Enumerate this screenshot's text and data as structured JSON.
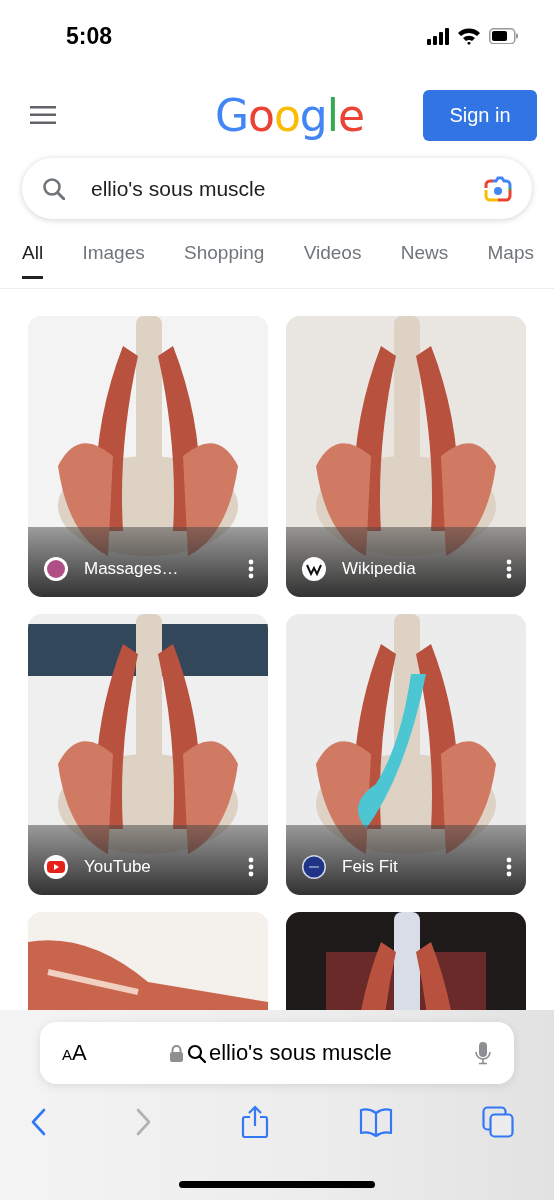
{
  "status_bar": {
    "time": "5:08"
  },
  "header": {
    "logo": "Google",
    "sign_in_button": "Sign in"
  },
  "search": {
    "value": "ellio's sous muscle"
  },
  "tabs": [
    {
      "label": "All",
      "selected": true
    },
    {
      "label": "Images",
      "selected": false
    },
    {
      "label": "Shopping",
      "selected": false
    },
    {
      "label": "Videos",
      "selected": false
    },
    {
      "label": "News",
      "selected": false
    },
    {
      "label": "Maps",
      "selected": false
    }
  ],
  "results": [
    {
      "kind": "picture",
      "source": "Massages…"
    },
    {
      "kind": "picture",
      "source": "Wikipedia"
    },
    {
      "kind": "picture",
      "source": "YouTube"
    },
    {
      "kind": "picture",
      "source": "Feis Fit"
    },
    {
      "kind": "picture"
    },
    {
      "kind": "picture"
    }
  ],
  "safari_bar": {
    "text_size_button": "AA",
    "address": "ellio's sous muscle"
  },
  "toolbar": [
    {
      "kind": "back",
      "disabled": false
    },
    {
      "kind": "forward",
      "disabled": true
    },
    {
      "kind": "share"
    },
    {
      "kind": "bookmarks"
    },
    {
      "kind": "tabs"
    }
  ]
}
